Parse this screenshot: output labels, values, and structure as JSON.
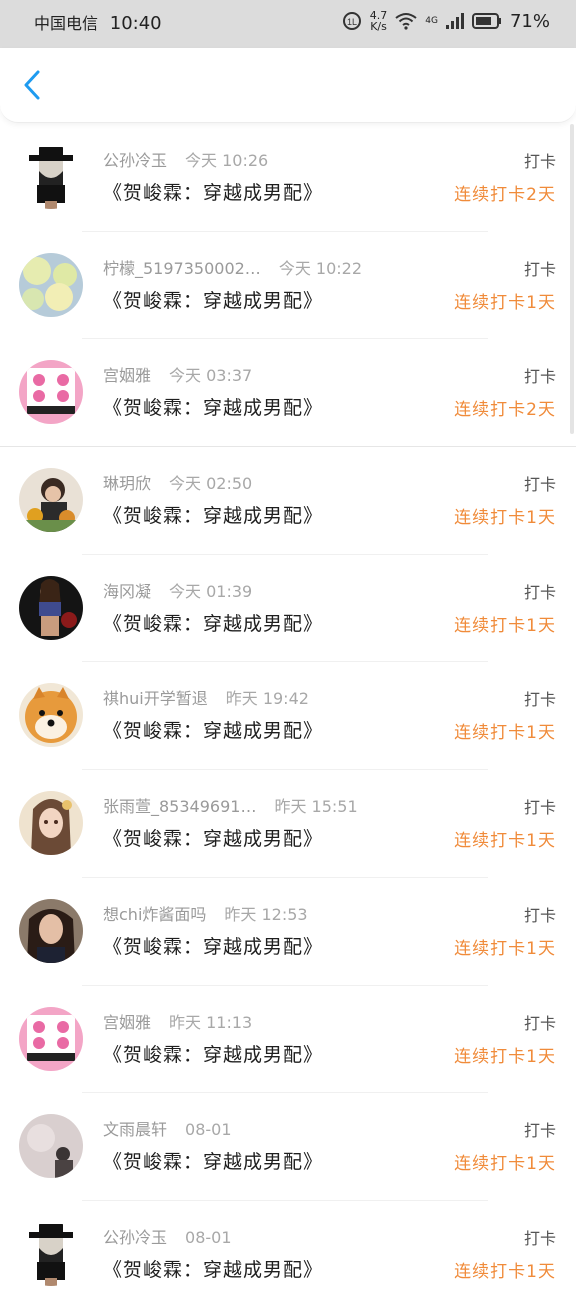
{
  "status_bar": {
    "carrier": "中国电信",
    "time": "10:40",
    "speed_value": "4.7",
    "speed_unit": "K/s",
    "network": "4G",
    "battery": "71%"
  },
  "nav": {
    "back_icon": "chevron-left-icon"
  },
  "colors": {
    "accent_blue": "#1e9bf0",
    "streak_orange": "#f08b3a"
  },
  "list": [
    {
      "user": "公孙冷玉",
      "time": "今天 10:26",
      "book": "《贺峻霖：穿越成男配》",
      "action": "打卡",
      "streak": "连续打卡2天",
      "avatar": "masked-figure"
    },
    {
      "user": "柠檬_5197350002…",
      "time": "今天 10:22",
      "book": "《贺峻霖：穿越成男配》",
      "action": "打卡",
      "streak": "连续打卡1天",
      "avatar": "lemon-slices"
    },
    {
      "user": "宫姻雅",
      "time": "今天 03:37",
      "book": "《贺峻霖：穿越成男配》",
      "action": "打卡",
      "streak": "连续打卡2天",
      "avatar": "pink-panther"
    },
    {
      "user": "琳玥欣",
      "time": "今天 02:50",
      "book": "《贺峻霖：穿越成男配》",
      "action": "打卡",
      "streak": "连续打卡1天",
      "avatar": "girl-flowers"
    },
    {
      "user": "海冈凝",
      "time": "今天 01:39",
      "book": "《贺峻霖：穿越成男配》",
      "action": "打卡",
      "streak": "连续打卡1天",
      "avatar": "fitness-woman"
    },
    {
      "user": "祺hui开学暂退",
      "time": "昨天 19:42",
      "book": "《贺峻霖：穿越成男配》",
      "action": "打卡",
      "streak": "连续打卡1天",
      "avatar": "shiba-dog"
    },
    {
      "user": "张雨萱_85349691…",
      "time": "昨天 15:51",
      "book": "《贺峻霖：穿越成男配》",
      "action": "打卡",
      "streak": "连续打卡1天",
      "avatar": "anime-girl"
    },
    {
      "user": "想chi炸酱面吗",
      "time": "昨天 12:53",
      "book": "《贺峻霖：穿越成男配》",
      "action": "打卡",
      "streak": "连续打卡1天",
      "avatar": "girl-portrait"
    },
    {
      "user": "宫姻雅",
      "time": "昨天 11:13",
      "book": "《贺峻霖：穿越成男配》",
      "action": "打卡",
      "streak": "连续打卡1天",
      "avatar": "pink-panther"
    },
    {
      "user": "文雨晨轩",
      "time": "08-01",
      "book": "《贺峻霖：穿越成男配》",
      "action": "打卡",
      "streak": "连续打卡1天",
      "avatar": "blurry-person"
    },
    {
      "user": "公孙冷玉",
      "time": "08-01",
      "book": "《贺峻霖：穿越成男配》",
      "action": "打卡",
      "streak": "连续打卡1天",
      "avatar": "masked-figure"
    }
  ]
}
